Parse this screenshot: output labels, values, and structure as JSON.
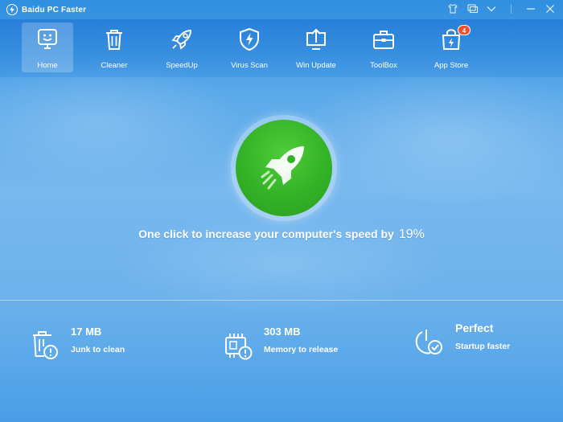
{
  "app": {
    "title": "Baidu PC Faster"
  },
  "toolbar": {
    "items": [
      {
        "label": "Home",
        "icon": "home-monitor-icon"
      },
      {
        "label": "Cleaner",
        "icon": "trash-icon"
      },
      {
        "label": "SpeedUp",
        "icon": "rocket-icon"
      },
      {
        "label": "Virus Scan",
        "icon": "shield-bolt-icon"
      },
      {
        "label": "Win Update",
        "icon": "upload-monitor-icon"
      },
      {
        "label": "ToolBox",
        "icon": "toolbox-icon"
      },
      {
        "label": "App Store",
        "icon": "shopping-bag-icon",
        "badge": "4"
      }
    ],
    "active": "Home"
  },
  "main": {
    "headline": "One click to increase your computer's speed by",
    "speed_percent": "19%"
  },
  "stats": [
    {
      "value": "17 MB",
      "label": "Junk to clean",
      "icon": "trash-warning-icon"
    },
    {
      "value": "303 MB",
      "label": "Memory to release",
      "icon": "memory-chip-warning-icon"
    },
    {
      "value": "Perfect",
      "label": "Startup faster",
      "icon": "startup-check-icon"
    }
  ],
  "colors": {
    "accent_green": "#34b227",
    "badge_red": "#f0502c",
    "bg_blue": "#5aa9ea"
  }
}
